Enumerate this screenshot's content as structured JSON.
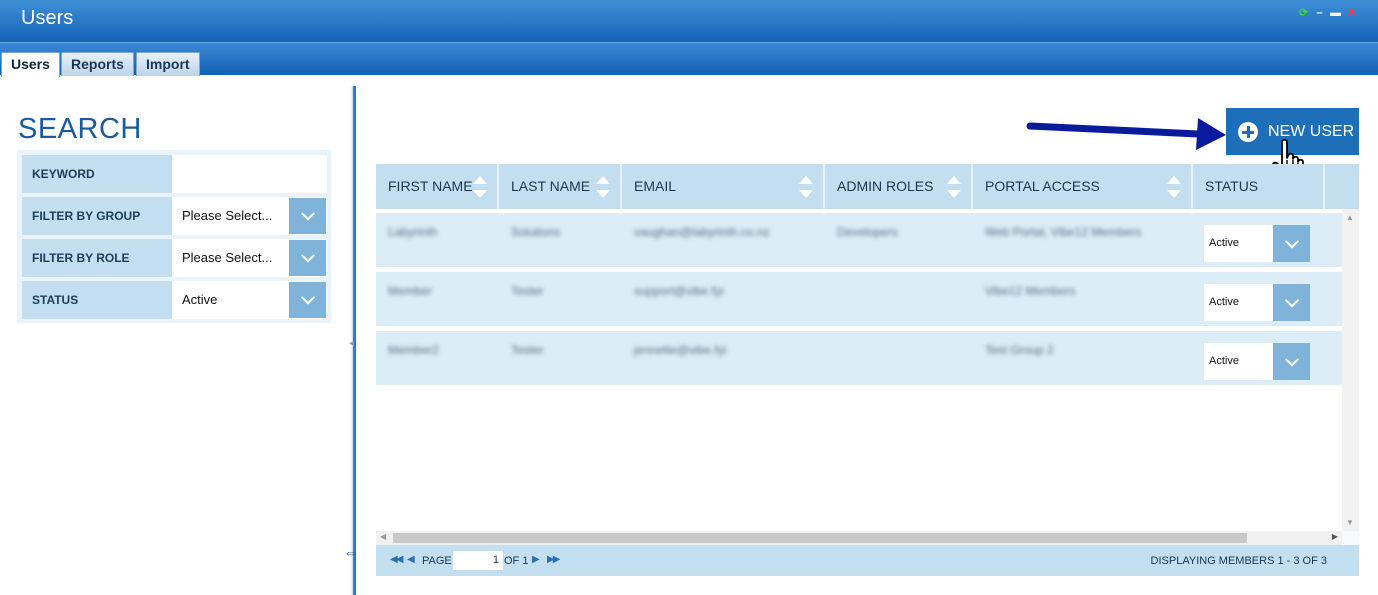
{
  "window": {
    "title": "Users"
  },
  "tabs": [
    {
      "label": "Users",
      "active": true
    },
    {
      "label": "Reports",
      "active": false
    },
    {
      "label": "Import",
      "active": false
    }
  ],
  "search": {
    "title": "SEARCH",
    "filters": [
      {
        "label": "KEYWORD",
        "value": ""
      },
      {
        "label": "FILTER BY GROUP",
        "value": "Please Select..."
      },
      {
        "label": "FILTER BY ROLE",
        "value": "Please Select..."
      },
      {
        "label": "STATUS",
        "value": "Active"
      }
    ]
  },
  "toolbar": {
    "new_user_label": "NEW USER"
  },
  "grid": {
    "columns": [
      "FIRST NAME",
      "LAST NAME",
      "EMAIL",
      "ADMIN ROLES",
      "PORTAL ACCESS",
      "STATUS"
    ],
    "rows": [
      {
        "first": "Labyrinth",
        "last": "Solutions",
        "email": "vaughan@labyrinth.co.nz",
        "roles": "Developers",
        "portal": "Web Portal, Vibe12 Members",
        "status": "Active"
      },
      {
        "first": "Member",
        "last": "Tester",
        "email": "support@vibe.fyi",
        "roles": "",
        "portal": "Vibe12 Members",
        "status": "Active"
      },
      {
        "first": "Member2",
        "last": "Tester",
        "email": "jennette@vibe.fyi",
        "roles": "",
        "portal": "Test Group 2",
        "status": "Active"
      }
    ]
  },
  "pager": {
    "page_label": "PAGE",
    "page_value": "1",
    "of_label": "OF 1",
    "summary": "DISPLAYING MEMBERS 1 - 3 OF 3"
  },
  "colors": {
    "header_blue": "#1663b8",
    "accent": "#1d6fb9",
    "grid_header": "#c3dfef",
    "dropdown": "#7fb3d9",
    "annotation_arrow": "#0a1a9c"
  },
  "icons": [
    "refresh-icon",
    "minimize-icon",
    "maximize-icon",
    "close-icon",
    "plus-circle-icon",
    "hand-cursor-icon",
    "annotation-arrow-icon",
    "chevron-down-icon",
    "sort-icon",
    "first-page-icon",
    "prev-page-icon",
    "next-page-icon",
    "last-page-icon",
    "resize-icon"
  ]
}
